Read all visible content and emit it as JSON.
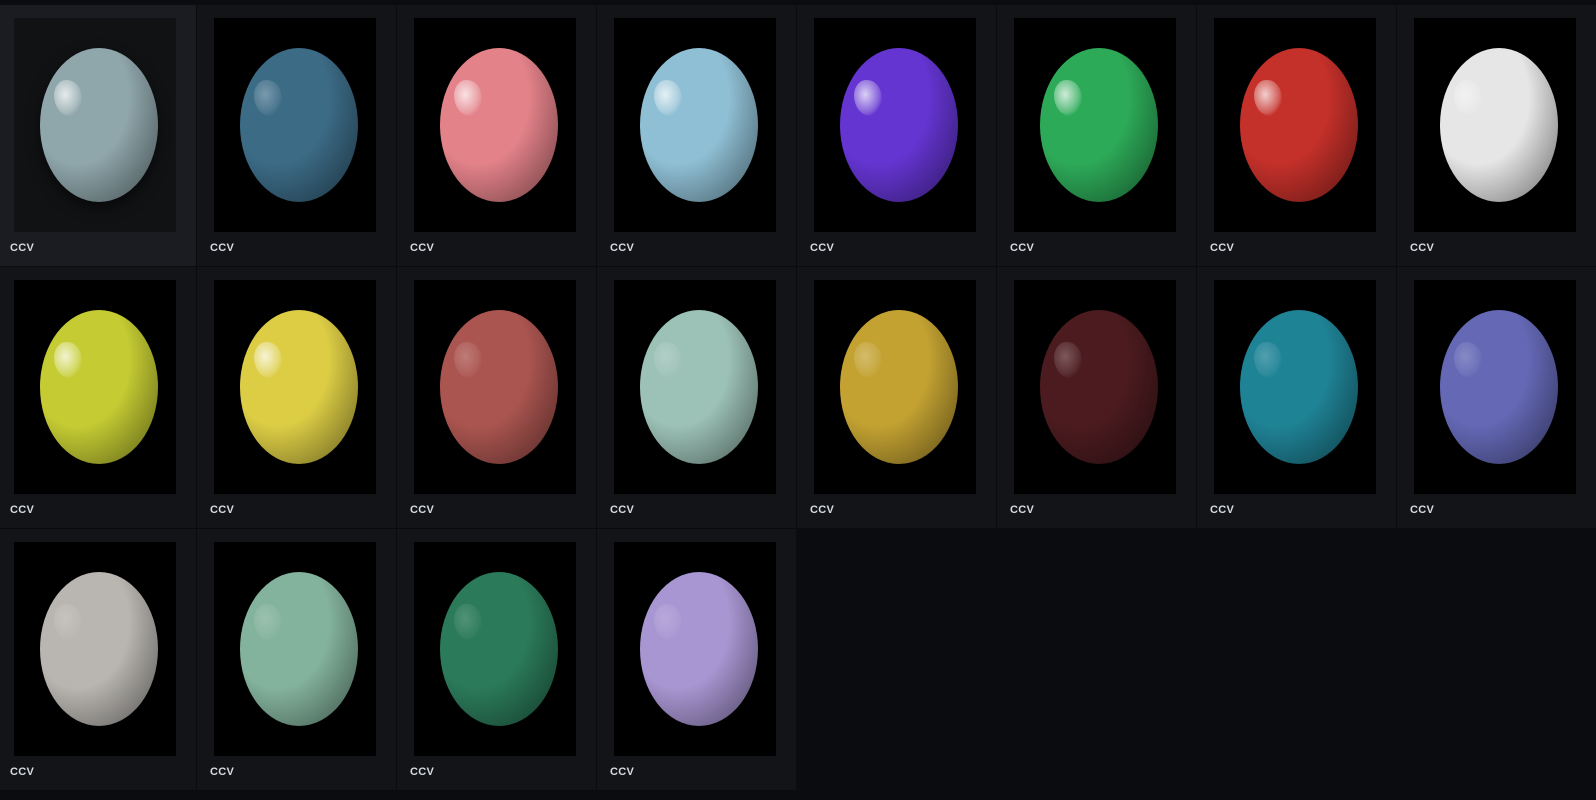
{
  "assets": [
    {
      "label": "CCV",
      "color": "#8fa6ab",
      "gloss": 0.85,
      "selected": true
    },
    {
      "label": "CCV",
      "color": "#3c6b86",
      "gloss": 0.35
    },
    {
      "label": "CCV",
      "color": "#e38289",
      "gloss": 0.85
    },
    {
      "label": "CCV",
      "color": "#8fbfd4",
      "gloss": 0.85
    },
    {
      "label": "CCV",
      "color": "#6435d1",
      "gloss": 0.85
    },
    {
      "label": "CCV",
      "color": "#2daa58",
      "gloss": 0.85
    },
    {
      "label": "CCV",
      "color": "#c4302a",
      "gloss": 0.85
    },
    {
      "label": "CCV",
      "color": "#e6e6e6",
      "gloss": 0.5
    },
    {
      "label": "CCV",
      "color": "#c5cc33",
      "gloss": 0.85
    },
    {
      "label": "CCV",
      "color": "#dccd45",
      "gloss": 0.85
    },
    {
      "label": "CCV",
      "color": "#ab5550",
      "gloss": 0.25
    },
    {
      "label": "CCV",
      "color": "#9cc1b6",
      "gloss": 0.25
    },
    {
      "label": "CCV",
      "color": "#c3a232",
      "gloss": 0.3
    },
    {
      "label": "CCV",
      "color": "#4b1b1f",
      "gloss": 0.3
    },
    {
      "label": "CCV",
      "color": "#1f8396",
      "gloss": 0.25
    },
    {
      "label": "CCV",
      "color": "#6468b5",
      "gloss": 0.25
    },
    {
      "label": "CCV",
      "color": "#b9b6b1",
      "gloss": 0.2
    },
    {
      "label": "CCV",
      "color": "#84b39d",
      "gloss": 0.2
    },
    {
      "label": "CCV",
      "color": "#2b7a5a",
      "gloss": 0.2
    },
    {
      "label": "CCV",
      "color": "#a896d2",
      "gloss": 0.2
    }
  ]
}
